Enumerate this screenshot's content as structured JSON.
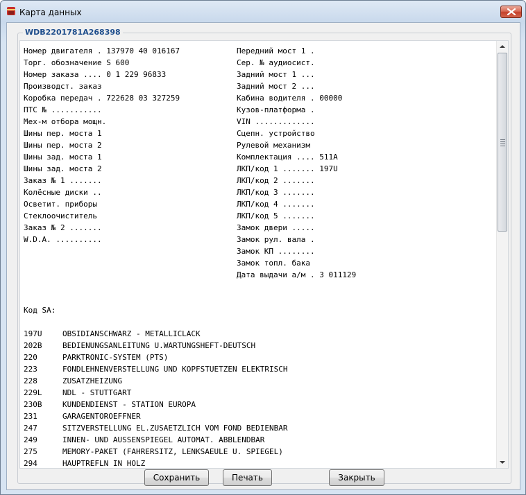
{
  "window": {
    "title": "Карта данных",
    "icon": "mercedes-star-icon",
    "close_icon": "close-x-icon",
    "accent_close": "#c4402b"
  },
  "group": {
    "title": "WDB2201781A268398"
  },
  "fields_left": [
    "Номер двигателя . 137970 40 016167",
    "Торг. обозначение S 600",
    "Номер заказа .... 0 1 229 96833",
    "Производст. заказ",
    "Коробка передач . 722628 03 327259",
    "ПТС № ...........",
    "Мех-м отбора мощн.",
    "Шины пер. моста 1",
    "Шины пер. моста 2",
    "Шины зад. моста 1",
    "Шины зад. моста 2",
    "Заказ № 1 .......",
    "Колёсные диски ..",
    "Осветит. приборы",
    "Стеклоочиститель",
    "Заказ № 2 .......",
    "W.D.A. .........."
  ],
  "fields_right": [
    "Передний мост 1 .",
    "Сер. № аудиосист.",
    "Задний мост 1 ...",
    "Задний мост 2 ...",
    "Кабина водителя . 00000",
    "Кузов-платформа .",
    "VIN .............",
    "Сцепн. устройство",
    "Рулевой механизм",
    "Комплектация .... 511A",
    "ЛКП/код 1 ....... 197U",
    "ЛКП/код 2 .......",
    "ЛКП/код 3 .......",
    "ЛКП/код 4 .......",
    "ЛКП/код 5 .......",
    "Замок двери .....",
    "Замок рул. вала .",
    "Замок КП ........",
    "Замок топл. бака",
    "Дата выдачи а/м . 3 011129"
  ],
  "sa": {
    "label": "Код SA:",
    "items": [
      {
        "code": "197U",
        "desc": "OBSIDIANSCHWARZ - METALLICLACK"
      },
      {
        "code": "202B",
        "desc": "BEDIENUNGSANLEITUNG U.WARTUNGSHEFT-DEUTSCH"
      },
      {
        "code": "220",
        "desc": "PARKTRONIC-SYSTEM (PTS)"
      },
      {
        "code": "223",
        "desc": "FONDLEHNENVERSTELLUNG UND KOPFSTUETZEN ELEKTRISCH"
      },
      {
        "code": "228",
        "desc": "ZUSATZHEIZUNG"
      },
      {
        "code": "229L",
        "desc": "NDL - STUTTGART"
      },
      {
        "code": "230B",
        "desc": "KUNDENDIENST - STATION EUROPA"
      },
      {
        "code": "231",
        "desc": "GARAGENTOROEFFNER"
      },
      {
        "code": "247",
        "desc": "SITZVERSTELLUNG EL.ZUSAETZLICH VOM FOND BEDIENBAR"
      },
      {
        "code": "249",
        "desc": "INNEN- UND AUSSENSPIEGEL AUTOMAT. ABBLENDBAR"
      },
      {
        "code": "275",
        "desc": "MEMORY-PAKET (FAHRERSITZ, LENKSAEULE U. SPIEGEL)"
      },
      {
        "code": "294",
        "desc": "HAUPTREFLN IN HOLZ"
      }
    ]
  },
  "buttons": {
    "save": "Сохранить",
    "print": "Печать",
    "close": "Закрыть"
  },
  "scrollbar": {
    "position": 0.0
  }
}
